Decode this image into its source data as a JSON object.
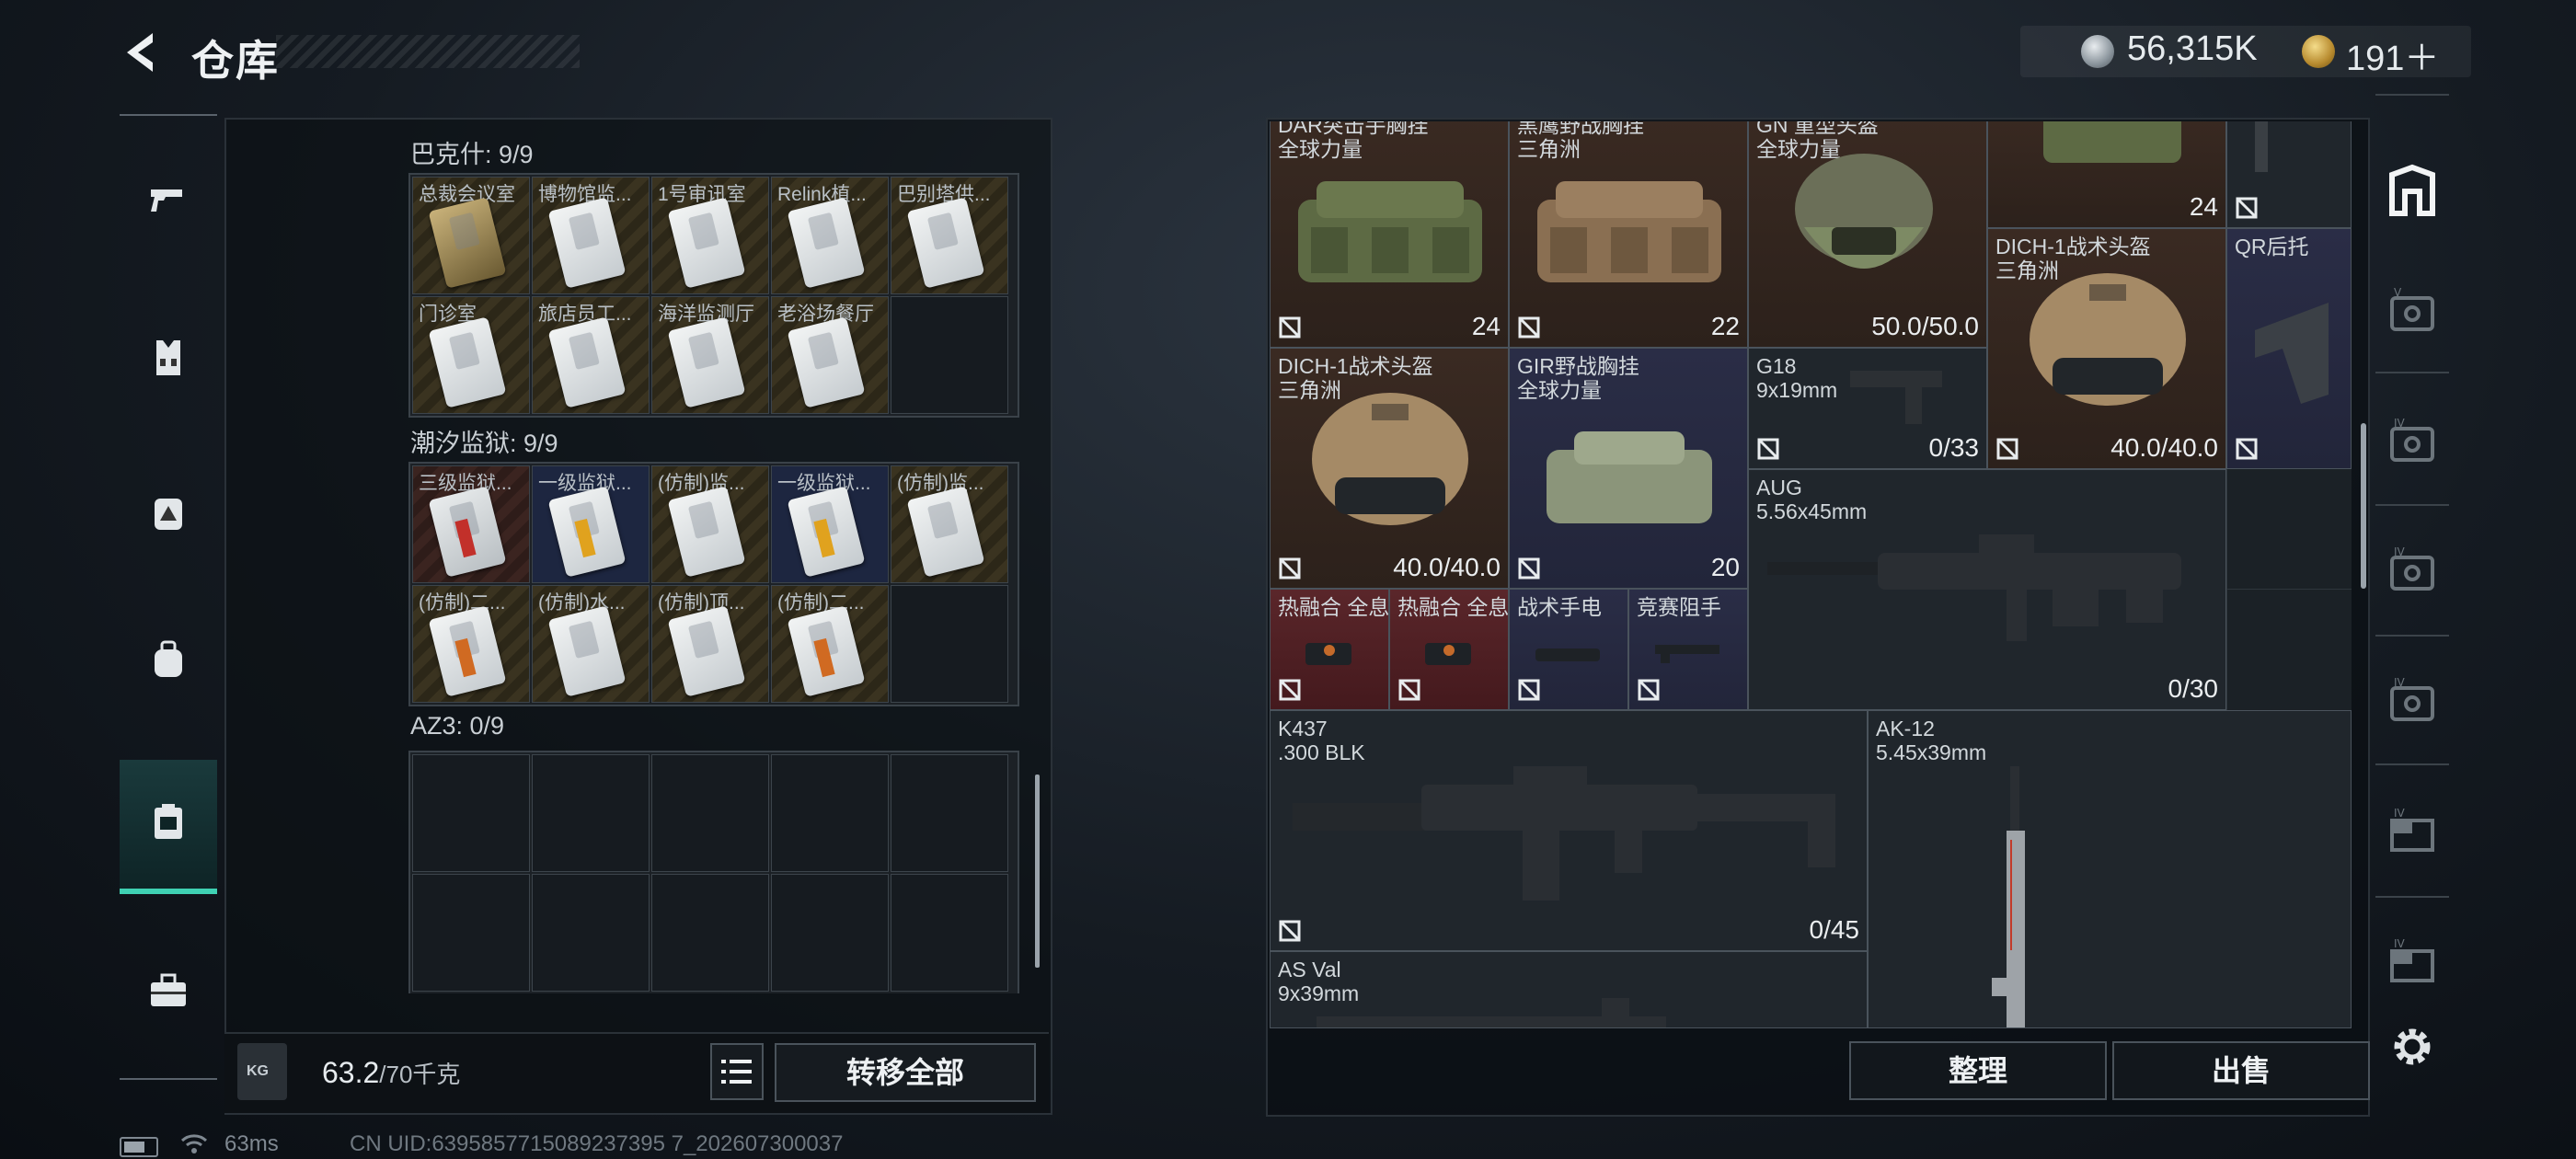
{
  "header": {
    "title": "仓库",
    "currency": {
      "coins": "56,315K",
      "gold": "191＋"
    }
  },
  "nav": {
    "items": [
      "pistol-icon",
      "vest-icon",
      "backpack-gear-icon",
      "backpack-icon",
      "storage-case-icon",
      "toolbox-icon"
    ],
    "active_index": 4
  },
  "left": {
    "groups": [
      {
        "label": "巴克什: 9/9",
        "cells": [
          "总裁会议室",
          "博物馆监...",
          "1号审讯室",
          "Relink植...",
          "巴别塔供...",
          "门诊室",
          "旅店员工...",
          "海洋监测厅",
          "老浴场餐厅"
        ]
      },
      {
        "label": "潮汐监狱: 9/9",
        "cells": [
          "三级监狱...",
          "一级监狱...",
          "(仿制)监...",
          "一级监狱...",
          "(仿制)监...",
          "(仿制)二...",
          "(仿制)水...",
          "(仿制)顶...",
          "(仿制)二..."
        ]
      },
      {
        "label": "AZ3: 0/9",
        "cells": []
      }
    ],
    "weight": {
      "value": "63.2",
      "max": "/70千克",
      "unit_icon": "KG"
    },
    "transfer_all": "转移全部"
  },
  "status": {
    "ping": "63ms",
    "uid": "CN UID:6395857715089237395 7_202607300037"
  },
  "stash": {
    "items": [
      {
        "n1": "DAR突击手胸挂",
        "n2": "全球力量",
        "count": "24"
      },
      {
        "n1": "黑鹰野战胸挂",
        "n2": "三角洲",
        "count": "22"
      },
      {
        "n1": "GN 重型头盔",
        "n2": "全球力量",
        "dur": "50.0/50.0"
      },
      {
        "n1": "",
        "n2": "",
        "count": "24"
      },
      {
        "n1": "DICH-1战术头盔",
        "n2": "三角洲",
        "dur": "40.0/40.0"
      },
      {
        "n1": "QR后托",
        "n2": ""
      },
      {
        "n1": "DICH-1战术头盔",
        "n2": "三角洲",
        "dur": "40.0/40.0"
      },
      {
        "n1": "GIR野战胸挂",
        "n2": "全球力量",
        "count": "20"
      },
      {
        "n1": "G18",
        "n2": "9x19mm",
        "ammo": "0/33"
      },
      {
        "n1": "AUG",
        "n2": "5.56x45mm",
        "ammo": "0/30"
      },
      {
        "n1": "热融合 全息",
        "n2": ""
      },
      {
        "n1": "热融合 全息",
        "n2": ""
      },
      {
        "n1": "战术手电",
        "n2": ""
      },
      {
        "n1": "竞赛阻手",
        "n2": ""
      },
      {
        "n1": "K437",
        "n2": ".300 BLK",
        "ammo": "0/45"
      },
      {
        "n1": "AK-12",
        "n2": "5.45x39mm"
      },
      {
        "n1": "AS Val",
        "n2": "9x39mm"
      }
    ],
    "sort": "整理",
    "sell": "出售"
  },
  "side_tabs": [
    "safe-icon",
    "stash-tab-1-icon",
    "stash-tab-2-icon",
    "stash-tab-3-icon",
    "stash-tab-4-icon",
    "stash-tab-5-icon",
    "stash-tab-6-icon"
  ],
  "colors": {
    "accent": "#3fd1b3",
    "brown": "#3a2a22",
    "navy": "#2a2d46",
    "red": "#5a262a"
  }
}
